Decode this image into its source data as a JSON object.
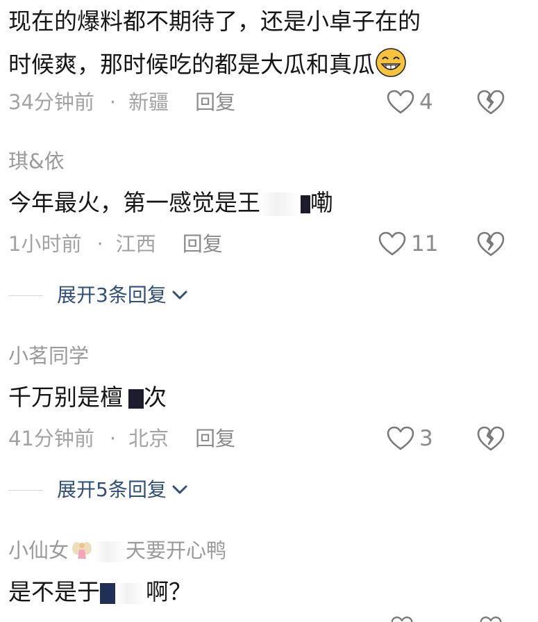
{
  "comments": [
    {
      "content_lines": [
        "现在的爆料都不期待了，还是小卓子在的",
        "时候爽，那时候吃的都是大瓜和真瓜"
      ],
      "emoji": "grinning-face",
      "time": "34分钟前",
      "location": "新疆",
      "reply_label": "回复",
      "likes": "4"
    },
    {
      "username": "琪&依",
      "content_before": "今年最火，第一感觉是王",
      "content_after": "嘞",
      "time": "1小时前",
      "location": "江西",
      "reply_label": "回复",
      "likes": "11",
      "expand_label": "展开3条回复"
    },
    {
      "username": "小茗同学",
      "content_before": "千万别是檀",
      "content_after": "次",
      "time": "41分钟前",
      "location": "北京",
      "reply_label": "回复",
      "likes": "3",
      "expand_label": "展开5条回复"
    },
    {
      "username_before": "小仙女",
      "username_after": "天要开心鸭",
      "content_before": "是不是于",
      "content_after": "啊？"
    }
  ],
  "icons": {
    "like": "heart-outline-icon",
    "dislike": "broken-heart-icon",
    "expand": "chevron-down-icon"
  },
  "colors": {
    "accent_link": "#2f4f7e",
    "meta_text": "#a3a3a3",
    "body_text": "#161616"
  }
}
